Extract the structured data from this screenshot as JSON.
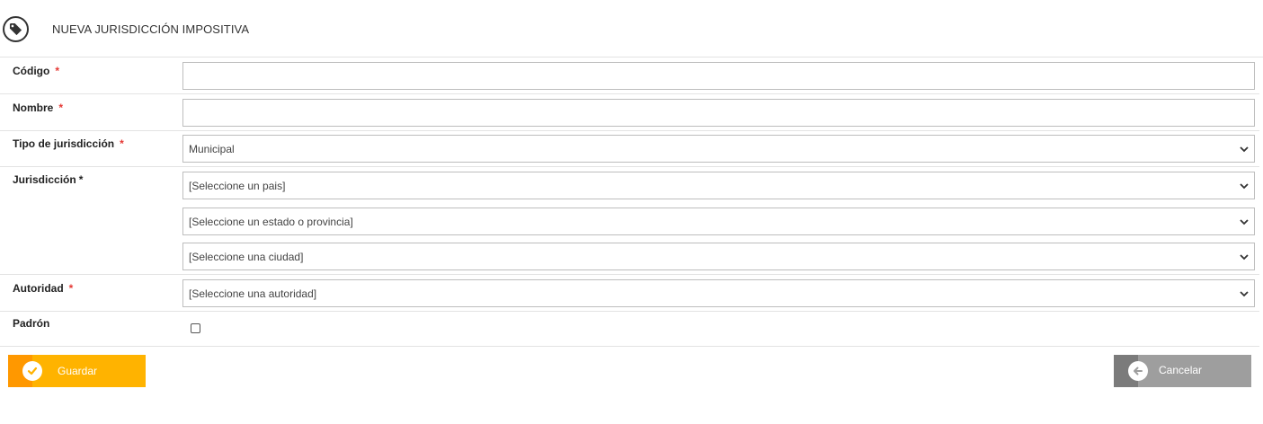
{
  "header": {
    "title": "NUEVA JURISDICCIÓN IMPOSITIVA",
    "icon": "tag-icon"
  },
  "form": {
    "codigo": {
      "label": "Código",
      "required_mark": "*",
      "value": ""
    },
    "nombre": {
      "label": "Nombre",
      "required_mark": "*",
      "value": ""
    },
    "tipo": {
      "label": "Tipo de jurisdicción",
      "required_mark": "*",
      "selected": "Municipal"
    },
    "jurisdiccion": {
      "label": "Jurisdicción",
      "required_mark": "*",
      "pais": "[Seleccione un pais]",
      "estado": "[Seleccione un estado o provincia]",
      "ciudad": "[Seleccione una ciudad]"
    },
    "autoridad": {
      "label": "Autoridad",
      "required_mark": "*",
      "selected": "[Seleccione una autoridad]"
    },
    "padron": {
      "label": "Padrón",
      "checked": false
    }
  },
  "actions": {
    "save_label": "Guardar",
    "cancel_label": "Cancelar"
  },
  "colors": {
    "save": "#ffb300",
    "save_accent": "#ff9800",
    "cancel": "#9e9e9e",
    "cancel_accent": "#7b7b7b",
    "required": "#e53935"
  }
}
